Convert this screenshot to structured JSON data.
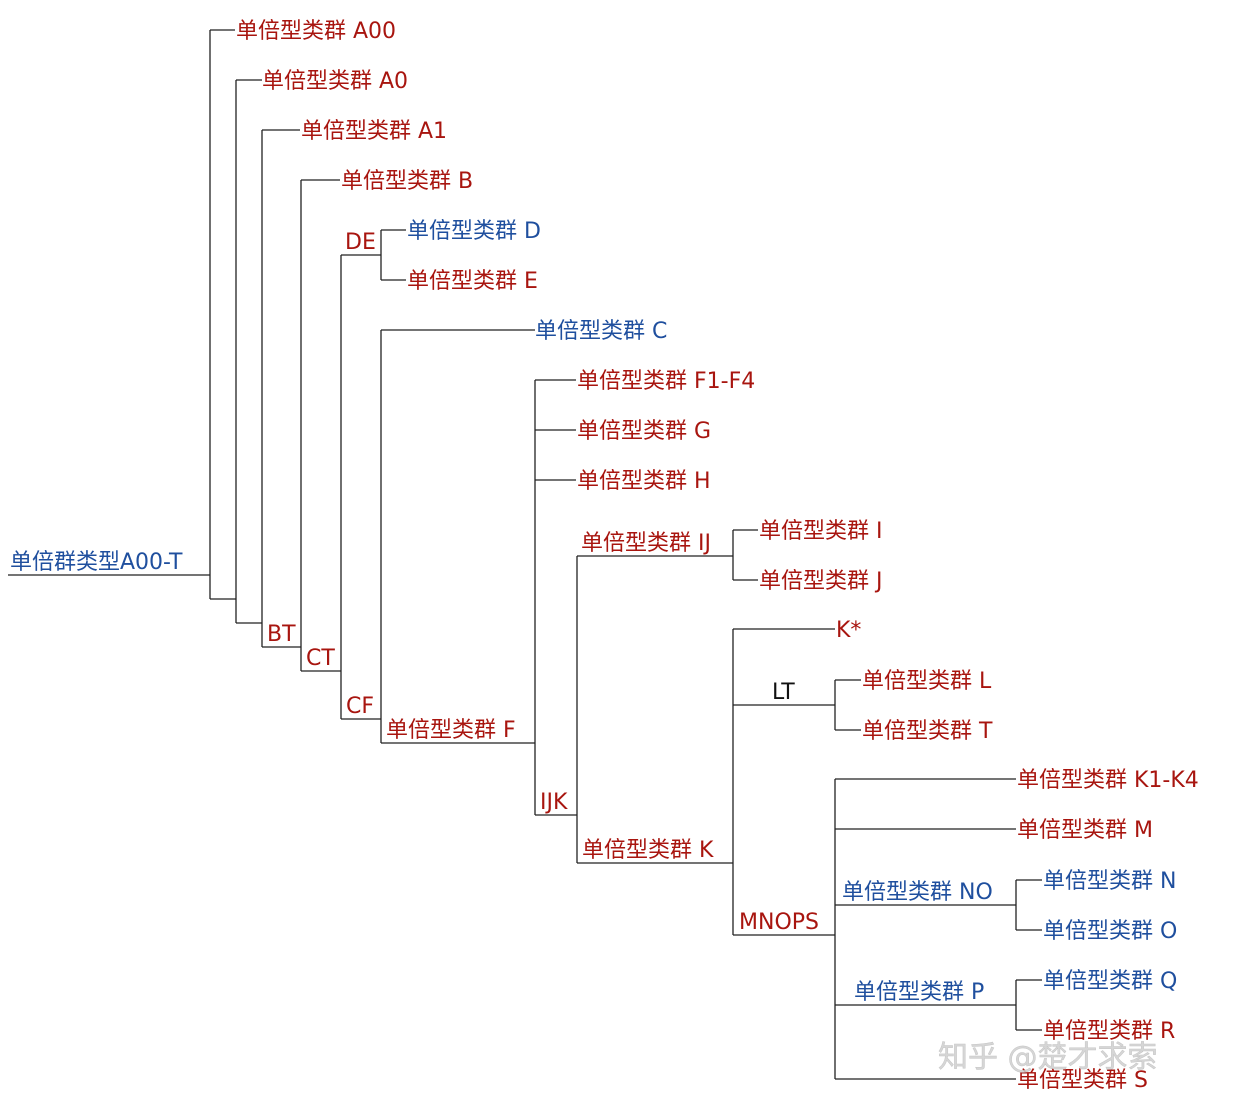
{
  "colors": {
    "red": "#a8150f",
    "blue": "#1f4f9e",
    "black": "#111111",
    "line": "#222222",
    "watermark": "#cccccc"
  },
  "nodes": {
    "root": {
      "label": "单倍群类型A00-T",
      "color": "blue"
    },
    "A00": {
      "label": "单倍型类群 A00",
      "color": "red"
    },
    "A0": {
      "label": "单倍型类群 A0",
      "color": "red"
    },
    "A1": {
      "label": "单倍型类群 A1",
      "color": "red"
    },
    "BT": {
      "label": "BT",
      "color": "red"
    },
    "B": {
      "label": "单倍型类群 B",
      "color": "red"
    },
    "CT": {
      "label": "CT",
      "color": "red"
    },
    "DE": {
      "label": "DE",
      "color": "red"
    },
    "D": {
      "label": "单倍型类群 D",
      "color": "blue"
    },
    "E": {
      "label": "单倍型类群 E",
      "color": "red"
    },
    "CF": {
      "label": "CF",
      "color": "red"
    },
    "C": {
      "label": "单倍型类群 C",
      "color": "blue"
    },
    "F": {
      "label": "单倍型类群 F",
      "color": "red"
    },
    "F1F4": {
      "label": "单倍型类群 F1-F4",
      "color": "red"
    },
    "G": {
      "label": "单倍型类群 G",
      "color": "red"
    },
    "H": {
      "label": "单倍型类群 H",
      "color": "red"
    },
    "IJK": {
      "label": "IJK",
      "color": "red"
    },
    "IJ": {
      "label": "单倍型类群 IJ",
      "color": "red"
    },
    "I": {
      "label": "单倍型类群 I",
      "color": "red"
    },
    "J": {
      "label": "单倍型类群 J",
      "color": "red"
    },
    "K": {
      "label": "单倍型类群 K",
      "color": "red"
    },
    "Kstar": {
      "label": "K*",
      "color": "red"
    },
    "LT": {
      "label": "LT",
      "color": "black"
    },
    "L": {
      "label": "单倍型类群 L",
      "color": "red"
    },
    "T": {
      "label": "单倍型类群 T",
      "color": "red"
    },
    "MNOPS": {
      "label": "MNOPS",
      "color": "red"
    },
    "K1K4": {
      "label": "单倍型类群 K1-K4",
      "color": "red"
    },
    "M": {
      "label": "单倍型类群 M",
      "color": "red"
    },
    "NO": {
      "label": "单倍型类群 NO",
      "color": "blue"
    },
    "N": {
      "label": "单倍型类群 N",
      "color": "blue"
    },
    "O": {
      "label": "单倍型类群 O",
      "color": "blue"
    },
    "P": {
      "label": "单倍型类群 P",
      "color": "blue"
    },
    "Q": {
      "label": "单倍型类群 Q",
      "color": "blue"
    },
    "R": {
      "label": "单倍型类群 R",
      "color": "red"
    },
    "S": {
      "label": "单倍型类群 S",
      "color": "red"
    }
  },
  "watermark": "知乎 @楚才求索"
}
